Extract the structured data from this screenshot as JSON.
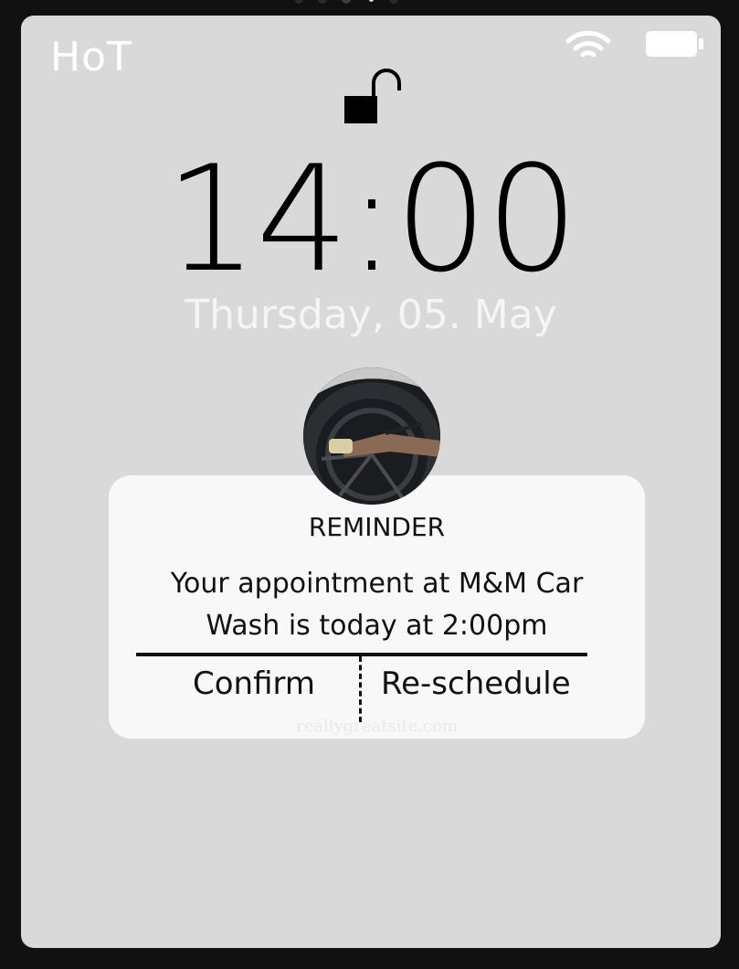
{
  "status_bar": {
    "carrier": "HoT",
    "wifi_icon": "wifi-icon",
    "battery_icon": "battery-icon"
  },
  "lock_screen": {
    "lock_icon": "unlocked-padlock-icon",
    "time": "14:00",
    "date": "Thursday, 05. May"
  },
  "notification": {
    "avatar": "car-wash-photo",
    "title": "REMINDER",
    "message": "Your appointment at M&M Car Wash is today at 2:00pm",
    "confirm_label": "Confirm",
    "reschedule_label": "Re-schedule",
    "watermark": "reallygreatsite.com"
  },
  "colors": {
    "screen_bg": "#d9d9d9",
    "bezel": "#111111",
    "card_bg": "#f8f8f8",
    "text": "#111111",
    "date_text": "#f5f5f5"
  }
}
